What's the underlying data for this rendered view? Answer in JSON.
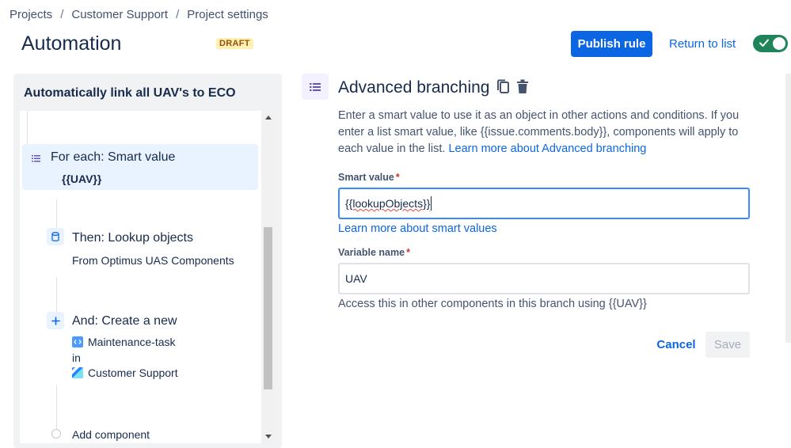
{
  "breadcrumb": {
    "items": [
      "Projects",
      "Customer Support",
      "Project settings"
    ],
    "separator": "/"
  },
  "header": {
    "title": "Automation",
    "badge": "DRAFT",
    "publish_label": "Publish rule",
    "return_label": "Return to list",
    "toggle_enabled": true
  },
  "rule": {
    "name": "Automatically link all UAV's to ECO",
    "components": [
      {
        "type": "branch",
        "title": "For each: Smart value",
        "detail": "{{UAV}}",
        "selected": true,
        "icon": "list-icon"
      },
      {
        "type": "action",
        "title": "Then: Lookup objects",
        "detail": "From Optimus UAS Components",
        "icon": "database-icon"
      },
      {
        "type": "action",
        "title": "And: Create a new",
        "issue_type": "Maintenance-task",
        "connector": "in",
        "project": "Customer Support",
        "icon": "plus-icon"
      }
    ],
    "add_component_label": "Add component"
  },
  "editor": {
    "title": "Advanced branching",
    "description_text": "Enter a smart value to use it as an object in other actions and conditions. If you enter a list smart value, like {{issue.comments.body}}, components will apply to each value in the list.",
    "description_link": "Learn more about Advanced branching",
    "smart_value_label": "Smart value",
    "smart_value": "{{lookupObjects}}",
    "smart_value_link": "Learn more about smart values",
    "variable_label": "Variable name",
    "variable_value": "UAV",
    "helper_text": "Access this in other components in this branch using {{UAV}}",
    "required_mark": "*",
    "cancel_label": "Cancel",
    "save_label": "Save"
  },
  "colors": {
    "primary": "#0c66e4",
    "toggle_on": "#1f845a",
    "draft_bg": "#fff0b3",
    "selected_bg": "#e9f2ff"
  }
}
